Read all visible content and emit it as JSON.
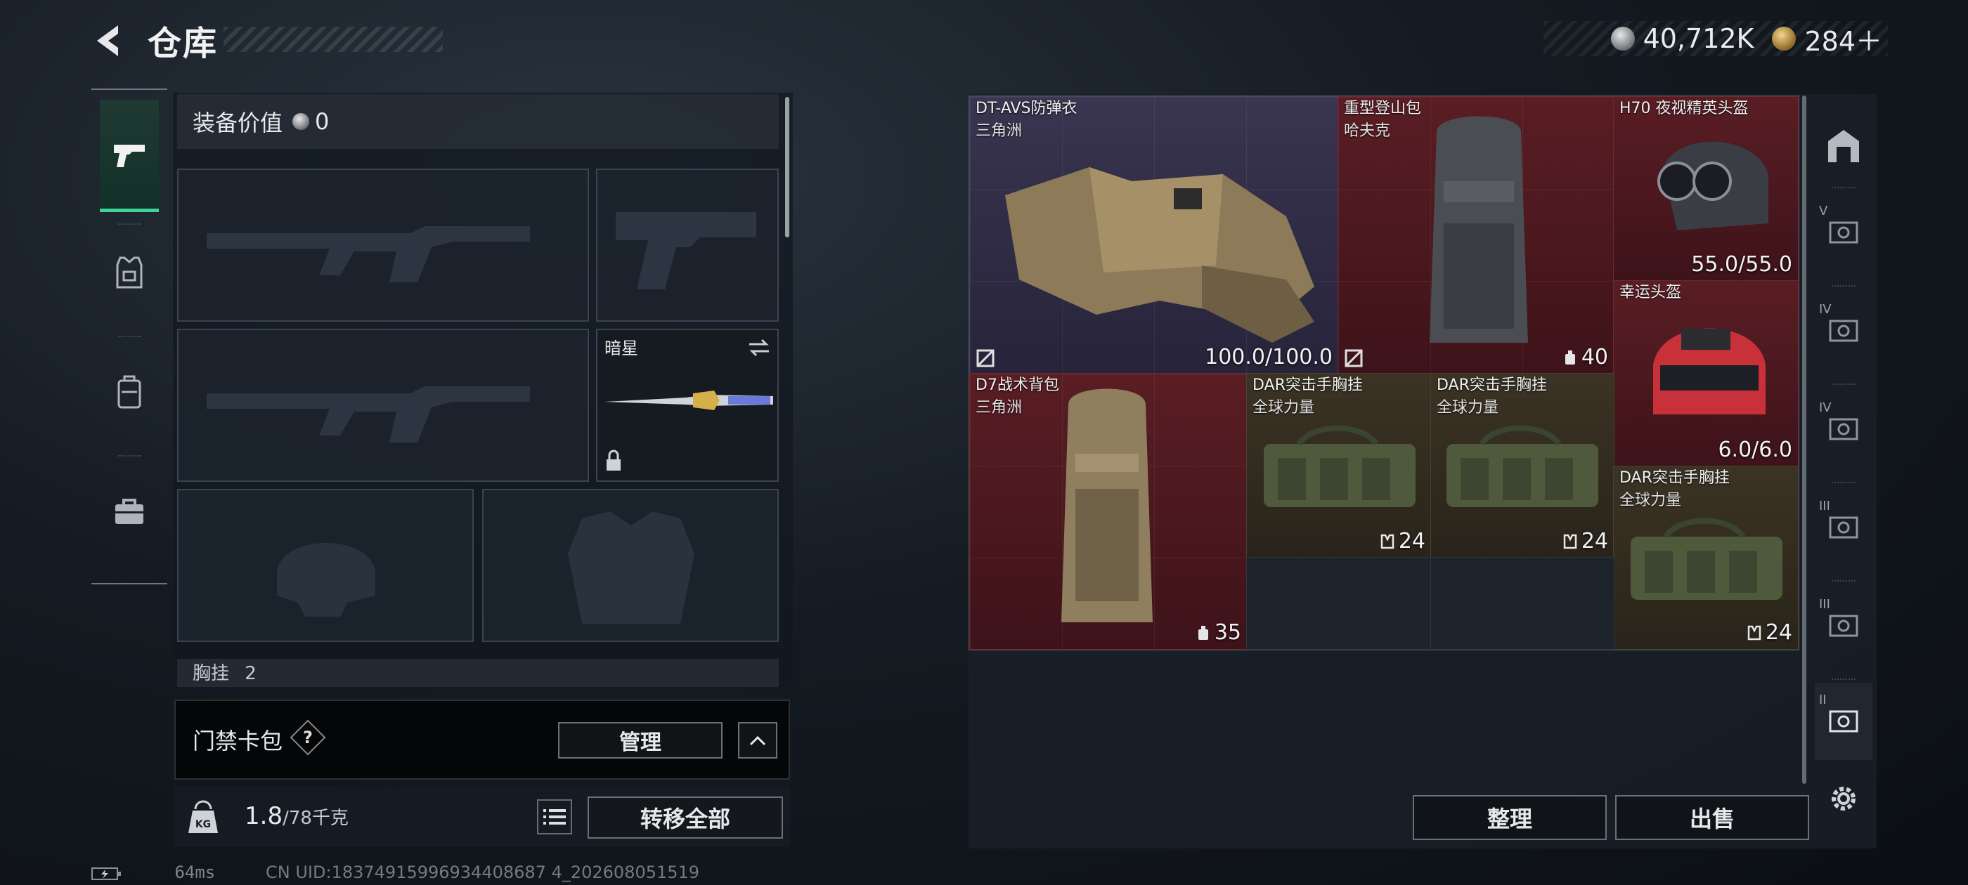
{
  "header": {
    "title": "仓库",
    "currency": [
      {
        "icon": "silver-coin-icon",
        "value": "40,712K"
      },
      {
        "icon": "gold-coin-icon",
        "value": "284＋"
      }
    ]
  },
  "nav": {
    "items": [
      {
        "icon": "pistol-icon",
        "active": true
      },
      {
        "icon": "armor-vest-icon",
        "active": false
      },
      {
        "icon": "backpack-icon",
        "active": false
      },
      {
        "icon": "briefcase-icon",
        "active": false
      }
    ]
  },
  "loadout": {
    "equip_value_label": "装备价值",
    "equip_value": "0",
    "melee_label": "暗星",
    "chest_label": "胸挂",
    "chest_count": "2",
    "keycard_label": "门禁卡包",
    "help": "?",
    "manage_label": "管理",
    "weight_current": "1.8",
    "weight_max": "/78千克",
    "transfer_all_label": "转移全部"
  },
  "stash": {
    "items": [
      {
        "name": "DT-AVS防弹衣",
        "sub": "三角洲",
        "stat": "100.0/100.0",
        "color": "#2f2b45"
      },
      {
        "name": "重型登山包",
        "sub": "哈夫克",
        "stat": "40",
        "color": "#4a1a20"
      },
      {
        "name": "H70 夜视精英头盔",
        "sub": "",
        "stat": "55.0/55.0",
        "color": "#4a1a20"
      },
      {
        "name": "幸运头盔",
        "sub": "",
        "stat": "6.0/6.0",
        "color": "#4a1a20"
      },
      {
        "name": "D7战术背包",
        "sub": "三角洲",
        "stat": "35",
        "color": "#4a1a20"
      },
      {
        "name": "DAR突击手胸挂",
        "sub": "全球力量",
        "stat": "24",
        "color": "#3a3222"
      },
      {
        "name": "DAR突击手胸挂",
        "sub": "全球力量",
        "stat": "24",
        "color": "#3a3222"
      },
      {
        "name": "DAR突击手胸挂",
        "sub": "全球力量",
        "stat": "24",
        "color": "#3a3222"
      }
    ],
    "sort_label": "整理",
    "sell_label": "出售",
    "side_tabs": [
      {
        "icon": "home-stash-icon",
        "numeral": ""
      },
      {
        "icon": "stash-page-icon",
        "numeral": "V"
      },
      {
        "icon": "stash-page-icon",
        "numeral": "IV"
      },
      {
        "icon": "stash-page-icon",
        "numeral": "IV"
      },
      {
        "icon": "stash-page-icon",
        "numeral": "III"
      },
      {
        "icon": "stash-page-icon",
        "numeral": "III"
      },
      {
        "icon": "stash-page-icon",
        "numeral": "II"
      },
      {
        "icon": "gear-icon",
        "numeral": ""
      }
    ]
  },
  "footer": {
    "ping": "64ms",
    "uid": "CN UID:18374915996934408687 4_202608051519"
  }
}
